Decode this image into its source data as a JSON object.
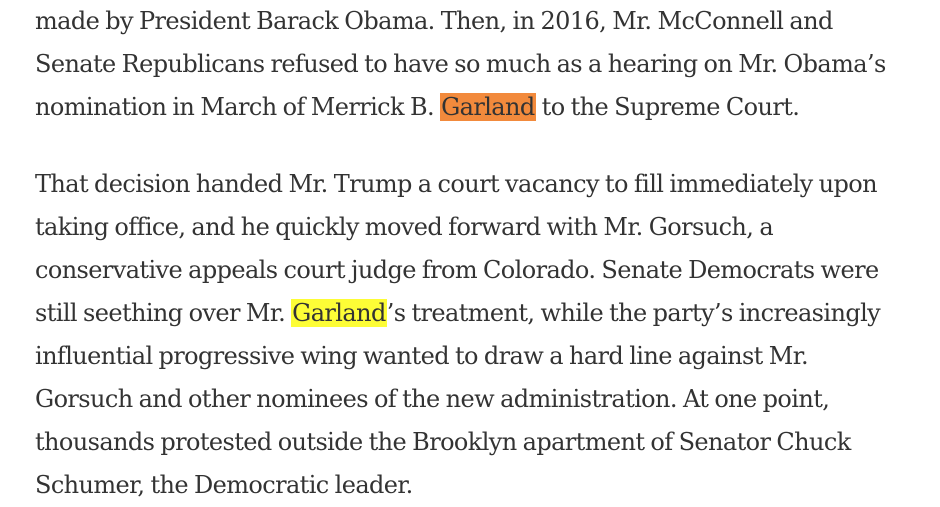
{
  "highlight_colors": {
    "current_match": "#f28a3c",
    "other_match": "#fdfd36"
  },
  "paragraph1": {
    "line1": "made by President Barack Obama. Then, in 2016, Mr. McConnell and",
    "line2": "Senate Republicans refused to have so much as a hearing on Mr. Obama’s",
    "line3_before": "nomination in March of Merrick B. ",
    "line3_highlight": "Garland",
    "line3_after": " to the Supreme Court."
  },
  "paragraph2": {
    "line1": "That decision handed Mr. Trump a court vacancy to fill immediately upon",
    "line2": "taking office, and he quickly moved forward with Mr. Gorsuch, a",
    "line3": "conservative appeals court judge from Colorado. Senate Democrats were",
    "line4_before": "still seething over Mr. ",
    "line4_highlight": "Garland",
    "line4_after": "’s treatment, while the party’s increasingly",
    "line5": "influential progressive wing wanted to draw a hard line against Mr.",
    "line6": "Gorsuch and other nominees of the new administration. At one point,",
    "line7": "thousands protested outside the Brooklyn apartment of Senator Chuck",
    "line8": "Schumer, the Democratic leader."
  }
}
